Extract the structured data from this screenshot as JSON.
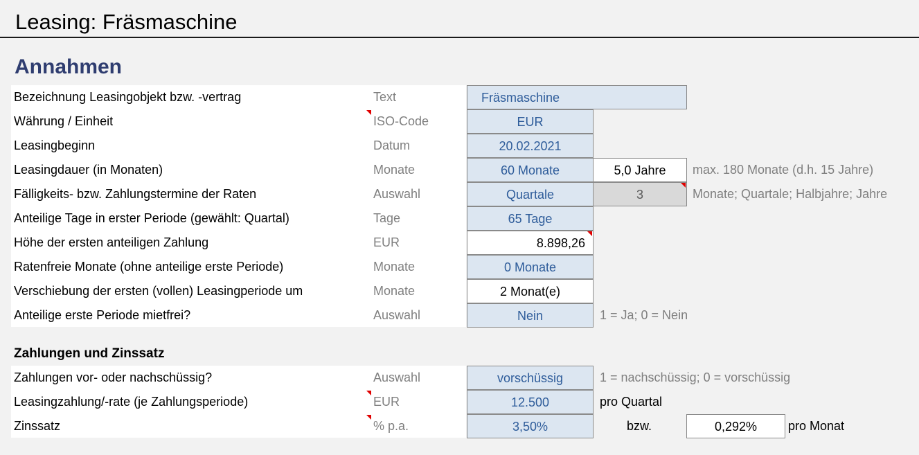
{
  "title": "Leasing: Fräsmaschine",
  "section1": {
    "heading": "Annahmen",
    "rows": [
      {
        "label": "Bezeichnung Leasingobjekt bzw. -vertrag",
        "unit": "Text",
        "value": "Fräsmaschine"
      },
      {
        "label": "Währung / Einheit",
        "unit": "ISO-Code",
        "value": "EUR"
      },
      {
        "label": "Leasingbeginn",
        "unit": "Datum",
        "value": "20.02.2021"
      },
      {
        "label": "Leasingdauer (in Monaten)",
        "unit": "Monate",
        "value": "60 Monate",
        "extra": "5,0 Jahre",
        "note": "max. 180 Monate (d.h. 15 Jahre)"
      },
      {
        "label": "Fälligkeits- bzw. Zahlungstermine der Raten",
        "unit": "Auswahl",
        "value": "Quartale",
        "extra": "3",
        "note": "Monate; Quartale; Halbjahre; Jahre"
      },
      {
        "label": "Anteilige Tage in erster Periode (gewählt: Quartal)",
        "unit": "Tage",
        "value": "65 Tage"
      },
      {
        "label": "Höhe der ersten anteiligen Zahlung",
        "unit": "EUR",
        "value": "8.898,26"
      },
      {
        "label": "Ratenfreie Monate (ohne anteilige erste Periode)",
        "unit": "Monate",
        "value": "0 Monate"
      },
      {
        "label": "Verschiebung der ersten (vollen) Leasingperiode um",
        "unit": "Monate",
        "value": "2 Monat(e)"
      },
      {
        "label": "Anteilige erste Periode mietfrei?",
        "unit": "Auswahl",
        "value": "Nein",
        "note": "1 = Ja; 0 = Nein"
      }
    ]
  },
  "section2": {
    "heading": "Zahlungen und Zinssatz",
    "rows": [
      {
        "label": "Zahlungen vor- oder nachschüssig?",
        "unit": "Auswahl",
        "value": "vorschüssig",
        "note": "1 = nachschüssig; 0 = vorschüssig"
      },
      {
        "label": "Leasingzahlung/-rate (je Zahlungsperiode)",
        "unit": "EUR",
        "value": "12.500",
        "note": "pro Quartal"
      },
      {
        "label": "Zinssatz",
        "unit": "% p.a.",
        "value": "3,50%",
        "note_before": "bzw.",
        "extra": "0,292%",
        "note": "pro Monat"
      }
    ]
  },
  "colors": {
    "heading": "#2f3d70",
    "input_fill": "#dce6f1",
    "input_text": "#2e5c9a",
    "comment_flag": "#e00000",
    "formula_fill": "#d9d9d9"
  }
}
